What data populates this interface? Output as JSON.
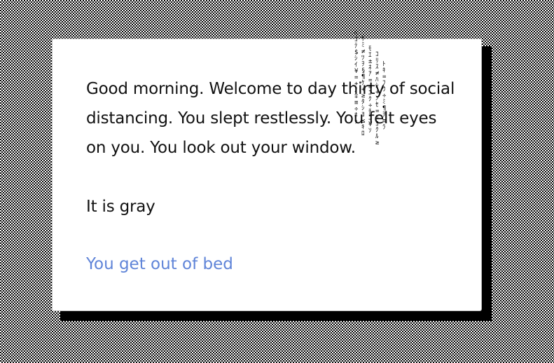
{
  "story": {
    "paragraph1": "Good morning. Welcome to day thirty of social distancing. You slept restlessly. You felt eyes on you. You look out your window.",
    "paragraph2": "It is gray"
  },
  "choice": {
    "label": "You get out of bed"
  },
  "colors": {
    "link": "#5f84d8",
    "text": "#111111",
    "shadow": "#000000"
  },
  "glitch_columns": [
    "ﾍ\nｺ\nﾃ\n$\nｼ\nｲ\n¥\n=\n+\nﾉ\n∓\n≡\n÷\nﾎ\nｯ",
    "ｻ\nﾐ\n≠\nﾂ\nｦ\n§\n¶\nｹ\n+\n≥\nﾀ\nｼ\nﾖ\n≤\nｷ\nﾛ",
    "ﾓ\nｴ\n±\nﾈ\nｱ\n=\n≡\nﾕ\nｸ\n÷\nﾁ\nﾆ\n¥\nｿ",
    "ｺ\nﾘ\nｽ\n≠\nﾊ\nｼ\n+\nﾝ\nｾ\n=\nﾍ\nﾖ\nｸ\nﾙ\n≥",
    "ﾄ\nｷ\n=\nﾌ\nｳ\n÷\nﾐ\n¶\nｦ\n≡\nﾗ"
  ]
}
